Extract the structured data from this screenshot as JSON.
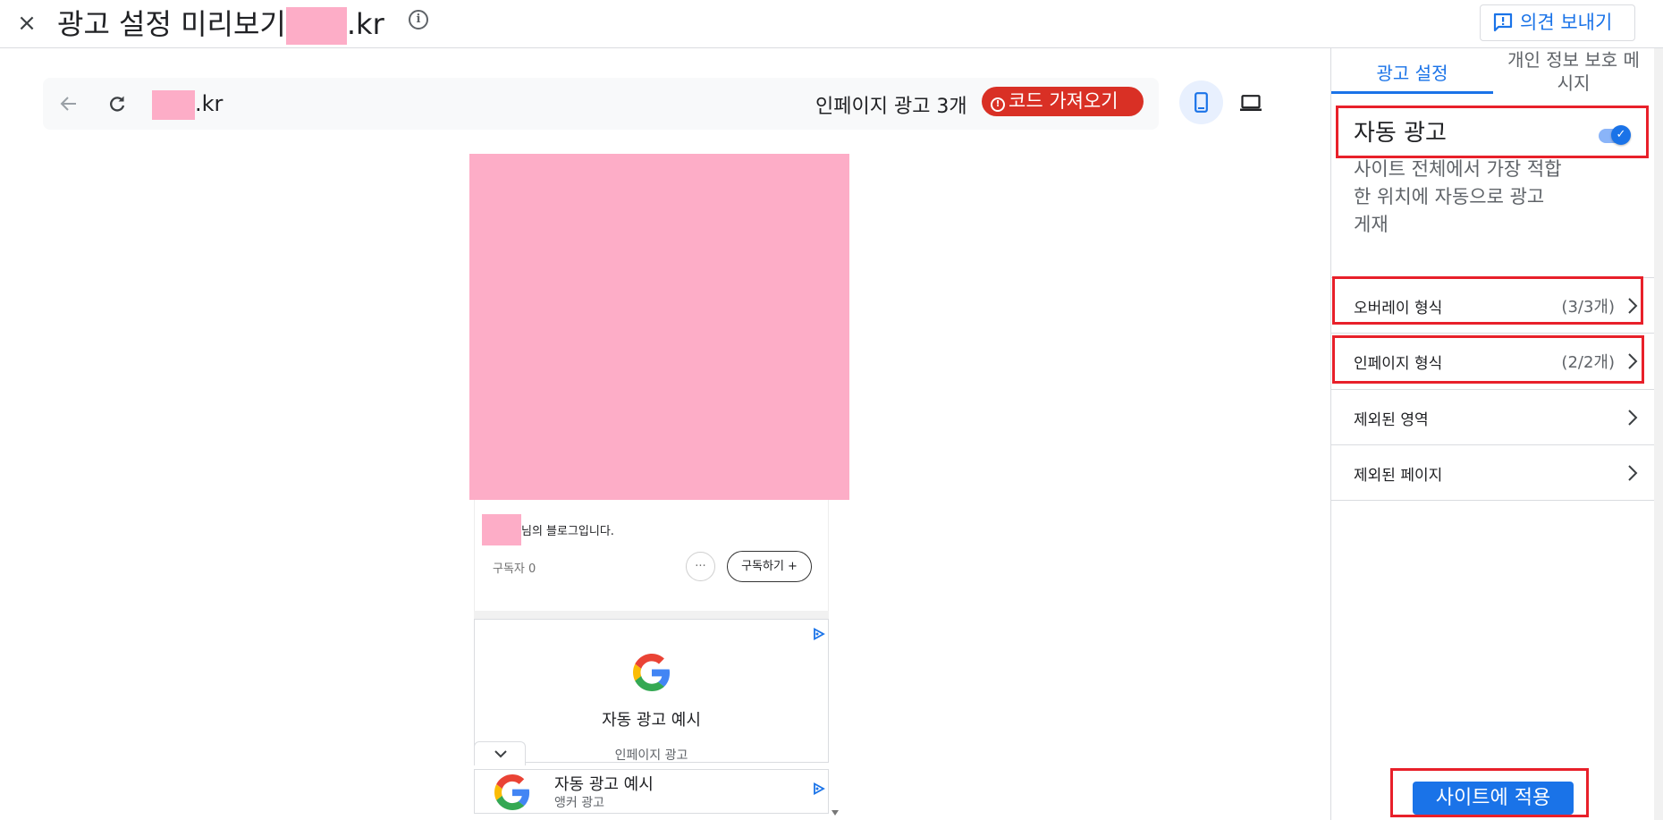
{
  "topbar": {
    "close_label": "×",
    "title_prefix": "광고 설정 미리보기",
    "title_suffix": ".kr",
    "feedback_label": "의견 보내기"
  },
  "preview_bar": {
    "url_suffix": ".kr",
    "inpage_count_label": "인페이지 광고 3개",
    "get_code_label": "코드 가져오기"
  },
  "blog": {
    "description": "님의 블로그입니다.",
    "subscribers": "구독자 0",
    "subscribe_label": "구독하기 +"
  },
  "inpage_ad": {
    "title": "자동 광고 예시",
    "type": "인페이지 광고"
  },
  "anchor_ad": {
    "title": "자동 광고 예시",
    "type": "앵커 광고"
  },
  "panel": {
    "tabs": [
      {
        "label": "광고 설정",
        "active": true
      },
      {
        "label_line1": "개인 정보 보호 메",
        "label_line2": "시지",
        "active": false
      }
    ],
    "auto_ads": {
      "title": "자동 광고",
      "enabled": true,
      "description": "사이트 전체에서 가장 적합한 위치에 자동으로 광고 게재"
    },
    "rows": [
      {
        "label": "오버레이 형식",
        "count": "(3/3개)"
      },
      {
        "label": "인페이지 형식",
        "count": "(2/2개)"
      },
      {
        "label": "제외된 영역",
        "count": ""
      },
      {
        "label": "제외된 페이지",
        "count": ""
      }
    ],
    "apply_label": "사이트에 적용"
  },
  "colors": {
    "accent": "#1a73e8",
    "danger": "#d93025",
    "redaction": "#fdadc7",
    "highlight_box": "#e8202a"
  },
  "icons": [
    "close-icon",
    "info-icon",
    "feedback-icon",
    "back-arrow-icon",
    "reload-icon",
    "alert-icon",
    "mobile-icon",
    "laptop-icon",
    "comment-icon",
    "adchoices-icon",
    "google-logo",
    "chevron-down-icon",
    "chevron-right-icon",
    "check-icon"
  ]
}
